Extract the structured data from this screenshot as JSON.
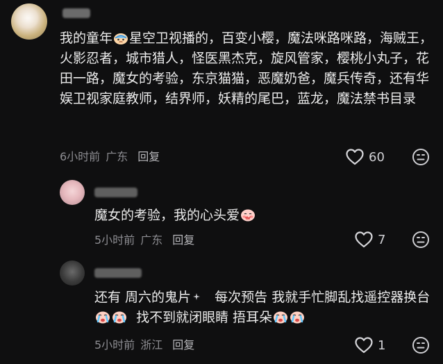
{
  "comments": [
    {
      "text_parts": [
        "我的童年",
        "星空卫视播的，百变小樱，魔法咪路咪路，海贼王，火影忍者，城市猎人，怪医黑杰克，旋风管家，樱桃小丸子，花田一路，魔女的考验，东京猫猫，恶魔奶爸，魔兵传奇，还有华娱卫视家庭教师，结界师，妖精的尾巴，蓝龙，魔法禁书目录"
      ],
      "time": "6小时前",
      "location": "广东",
      "reply_label": "回复",
      "likes": "60"
    },
    {
      "text_parts": [
        "魔女的考验，我的心头爱"
      ],
      "time": "5小时前",
      "location": "广东",
      "reply_label": "回复",
      "likes": "7"
    },
    {
      "text_parts": [
        "还有 周六的鬼片",
        "每次预告 我就手忙脚乱找遥控器换台",
        "找不到就闭眼睛 捂耳朵"
      ],
      "time": "5小时前",
      "location": "浙江",
      "reply_label": "回复",
      "likes": "1"
    }
  ],
  "icons": {
    "like": "heart-outline-icon",
    "dislike": "frown-face-icon",
    "emoji_sweat": "sweat-face-emoji",
    "emoji_cry": "crying-face-emoji",
    "emoji_shy": "shy-face-emoji",
    "emoji_sparkle": "sparkle-icon"
  }
}
